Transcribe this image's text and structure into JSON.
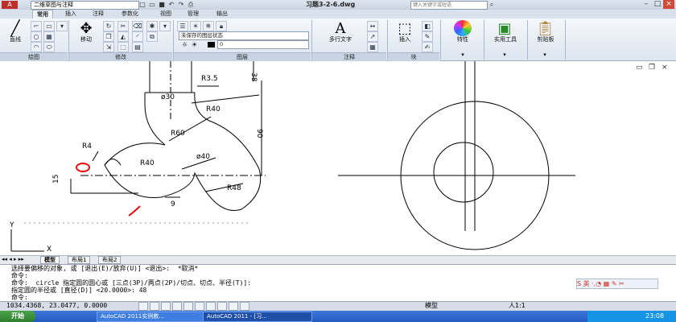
{
  "titlebar": {
    "app_logo": "A",
    "workspace": "二维草图与注释",
    "file_title": "习题3-2-6.dwg",
    "search_placeholder": "键入关键字或短语"
  },
  "tabs": [
    "常用",
    "插入",
    "注释",
    "参数化",
    "视图",
    "管理",
    "输出"
  ],
  "ribbon": {
    "draw": {
      "title": "绘图",
      "line_label": "直线"
    },
    "modify": {
      "title": "修改",
      "move_label": "移动"
    },
    "layers": {
      "title": "图层",
      "layer_state": "未保存的图层状态",
      "current_layer": "0"
    },
    "annotation": {
      "title": "注释",
      "mtext_label": "多行文字"
    },
    "block": {
      "title": "块",
      "insert_label": "插入"
    },
    "properties_label": "特性",
    "utilities_label": "实用工具",
    "clipboard_label": "剪贴板"
  },
  "drawing": {
    "dims": {
      "top_dim": "38",
      "r35": "R3.5",
      "d30": "ø30",
      "r40a": "R40",
      "r60": "R60",
      "r40b": "R40",
      "d40": "ø40",
      "right_dim": "90",
      "r4": "R4",
      "r48": "R48",
      "left_dim": "15",
      "bottom_dim": "9"
    },
    "ucs_y": "Y",
    "ucs_x": "X"
  },
  "layout_tabs": [
    "模型",
    "布局1",
    "布局2"
  ],
  "command": {
    "lines": [
      "选择要偏移的对象, 或 [退出(E)/放弃(U)] <退出>:  *取消*",
      "命令:",
      "命令:  circle 指定圆的圆心或 [三点(3P)/两点(2P)/切点、切点、半径(T)]:",
      "指定圆的半径或 [直径(D)] <20.0000>: 48",
      "命令:"
    ]
  },
  "status": {
    "coords": "1034.4368, 23.0477, 0.0000",
    "model": "模型",
    "scale": "人1:1"
  },
  "taskbar": {
    "start": "开始",
    "tasks": [
      "AutoCAD 2011实例教...",
      "AutoCAD 2011 - [习..."
    ],
    "clock": "23:08"
  },
  "colors": {
    "accent": "#2459c0",
    "ribbon": "#dde5ef",
    "mark_red": "#e01010"
  }
}
